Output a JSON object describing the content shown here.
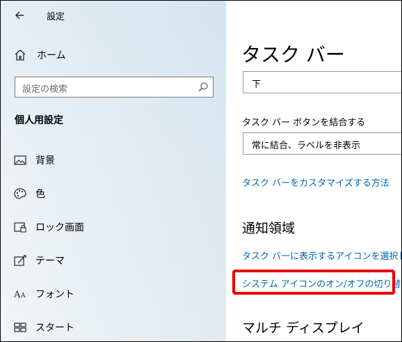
{
  "app": {
    "title": "設定"
  },
  "sidebar": {
    "home_label": "ホーム",
    "search_placeholder": "設定の検索",
    "section_title": "個人用設定",
    "items": [
      {
        "label": "背景",
        "icon": "picture-icon"
      },
      {
        "label": "色",
        "icon": "palette-icon"
      },
      {
        "label": "ロック画面",
        "icon": "lock-screen-icon"
      },
      {
        "label": "テーマ",
        "icon": "theme-icon"
      },
      {
        "label": "フォント",
        "icon": "font-icon"
      },
      {
        "label": "スタート",
        "icon": "start-icon"
      }
    ]
  },
  "main": {
    "title": "タスク バー",
    "position_value": "下",
    "combine_label": "タスク バー ボタンを結合する",
    "combine_value": "常に結合、ラベルを非表示",
    "customize_link": "タスク バーをカスタマイズする方法",
    "notification_title": "通知領域",
    "select_icons_link": "タスク バーに表示するアイコンを選択します",
    "system_icons_link": "システム アイコンのオン/オフの切り替え",
    "multi_display_title": "マルチ ディスプレイ"
  },
  "colors": {
    "link": "#0063b1",
    "highlight": "#ea0000"
  }
}
